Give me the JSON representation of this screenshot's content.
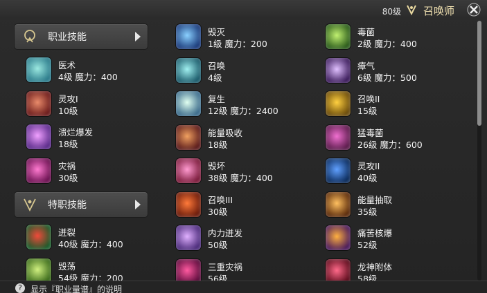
{
  "titlebar": {
    "level": "80级",
    "job": "召唤师",
    "job_icon": "summoner-job-icon",
    "close_icon": "close-icon"
  },
  "categories": [
    {
      "label": "职业技能",
      "icon": "job-skill-icon"
    },
    {
      "label": "特职技能",
      "icon": "special-job-skill-icon"
    }
  ],
  "skills_col1": [
    {
      "name": "医术",
      "sub": "4级 魔力：400",
      "colors": [
        "#2a7a8a",
        "#9be8e0"
      ]
    },
    {
      "name": "灵攻I",
      "sub": "10级",
      "colors": [
        "#6a1a1a",
        "#e88a6a"
      ]
    },
    {
      "name": "溃烂爆发",
      "sub": "18级",
      "colors": [
        "#5a2a8a",
        "#f0a0ff"
      ]
    },
    {
      "name": "灾祸",
      "sub": "30级",
      "colors": [
        "#6a1050",
        "#ff7ad0"
      ]
    }
  ],
  "skills_col1_b": [
    {
      "name": "迸裂",
      "sub": "40级 魔力：400",
      "colors": [
        "#1a5a2a",
        "#f04a3a"
      ]
    },
    {
      "name": "毁荡",
      "sub": "54级 魔力：200",
      "colors": [
        "#3a6a1a",
        "#d0f080"
      ]
    }
  ],
  "skills_col2": [
    {
      "name": "毁灭",
      "sub": "1级 魔力：200",
      "colors": [
        "#1a3a7a",
        "#8ad0ff"
      ]
    },
    {
      "name": "召唤",
      "sub": "4级",
      "colors": [
        "#1a5a6a",
        "#a0f0f0"
      ]
    },
    {
      "name": "复生",
      "sub": "12级 魔力：2400",
      "colors": [
        "#3a6a8a",
        "#e0fff0"
      ]
    },
    {
      "name": "能量吸收",
      "sub": "18级",
      "colors": [
        "#5a1a1a",
        "#f0a060"
      ]
    },
    {
      "name": "毁坏",
      "sub": "38级 魔力：400",
      "colors": [
        "#7a1a3a",
        "#ff9ad0"
      ]
    },
    {
      "name": "召唤III",
      "sub": "30级",
      "colors": [
        "#6a1a0a",
        "#ff7a3a"
      ]
    },
    {
      "name": "内力迸发",
      "sub": "50级",
      "colors": [
        "#4a2a7a",
        "#e0b0ff"
      ]
    },
    {
      "name": "三重灾祸",
      "sub": "56级",
      "colors": [
        "#5a0a3a",
        "#ff5aa0"
      ]
    }
  ],
  "skills_col3": [
    {
      "name": "毒菌",
      "sub": "2级 魔力：400",
      "colors": [
        "#2a5a1a",
        "#c0f070"
      ]
    },
    {
      "name": "瘴气",
      "sub": "6级 魔力：500",
      "colors": [
        "#3a1a5a",
        "#e0c0ff"
      ]
    },
    {
      "name": "召唤II",
      "sub": "15级",
      "colors": [
        "#6a4a0a",
        "#ffd040"
      ]
    },
    {
      "name": "猛毒菌",
      "sub": "26级 魔力：600",
      "colors": [
        "#5a1a4a",
        "#f070d0"
      ]
    },
    {
      "name": "灵攻II",
      "sub": "40级",
      "colors": [
        "#0a2a5a",
        "#60a0ff"
      ]
    },
    {
      "name": "能量抽取",
      "sub": "35级",
      "colors": [
        "#5a2a0a",
        "#ffc060"
      ]
    },
    {
      "name": "痛苦核爆",
      "sub": "52级",
      "colors": [
        "#4a1a5a",
        "#ffb040"
      ]
    },
    {
      "name": "龙神附体",
      "sub": "58级",
      "colors": [
        "#5a0a1a",
        "#ff6a8a"
      ]
    }
  ],
  "footer": {
    "text": "显示『职业量谱』的说明"
  }
}
